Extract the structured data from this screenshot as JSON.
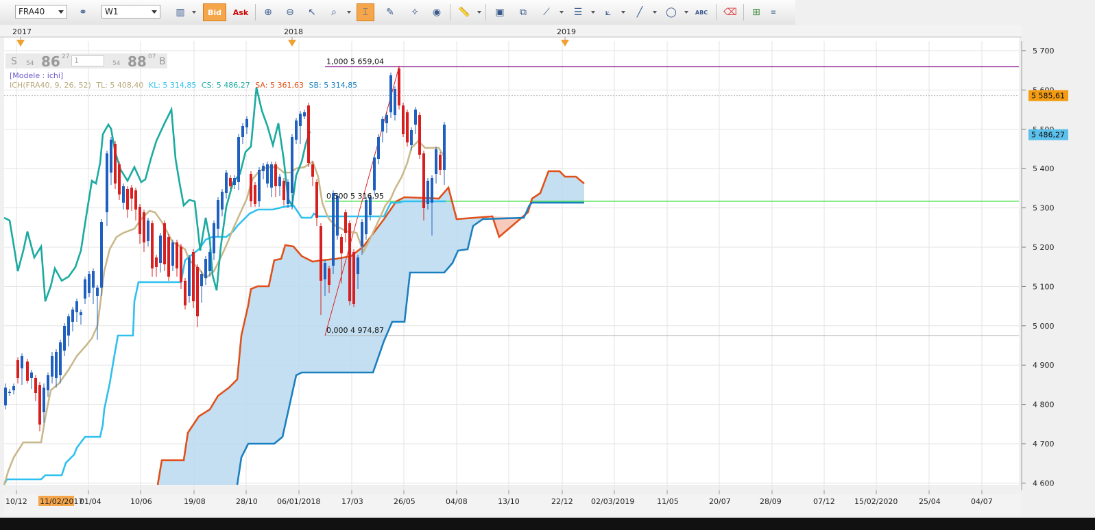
{
  "toolbar": {
    "symbol": "FRA40",
    "timeframe": "W1",
    "bid_label": "Bid",
    "ask_label": "Ask",
    "icons": [
      "chart-type-icon",
      "crosshair-icon",
      "zoom-in-icon",
      "zoom-out-icon",
      "cursor-icon",
      "zoom-box-icon",
      "period-icon",
      "edit-icon",
      "magic-icon",
      "globe-icon",
      "ruler-icon",
      "image-icon",
      "screenshot-icon",
      "trendline-icon",
      "levels-icon",
      "fibonacci-icon",
      "line-tool-icon",
      "ellipse-icon",
      "text-tool-icon",
      "eraser-icon",
      "indicators-icon",
      "more-icon"
    ]
  },
  "quote": {
    "sell_prefix": "S",
    "sell_small": "54",
    "sell_big": "86",
    "sell_sup": "27",
    "qty": "1",
    "buy_small": "54",
    "buy_big": "88",
    "buy_sup": "07",
    "buy_suffix": "B"
  },
  "legend": {
    "model": "[Modele : ichi]",
    "ich": "ICH(FRA40, 9, 26, 52)",
    "tl": "TL: 5 408,40",
    "kl": "KL: 5 314,85",
    "cs": "CS: 5 486,27",
    "sa": "SA: 5 361,63",
    "sb": "SB: 5 314,85"
  },
  "top_axis": {
    "years": [
      "2017",
      "2018",
      "2019"
    ]
  },
  "price_badges": [
    {
      "label": "5 585,61",
      "color": "#f39c12"
    },
    {
      "label": "5 486,27",
      "color": "#5bc0eb"
    }
  ],
  "fibonacci": [
    {
      "label": "1,000 5 659,04",
      "price": 5659.04
    },
    {
      "label": "0,500 5 316,95",
      "price": 5316.95
    },
    {
      "label": "0,000 4 974,87",
      "price": 4974.87
    }
  ],
  "chart_data": {
    "type": "candlestick",
    "title": "",
    "ylim": [
      4580,
      5720
    ],
    "y_ticks": [
      "5 700",
      "5 600",
      "5 500",
      "5 400",
      "5 300",
      "5 200",
      "5 100",
      "5 000",
      "4 900",
      "4 800",
      "4 700",
      "4 600"
    ],
    "x_tick_labels": [
      "10/12",
      "11/02/2017",
      "01/04",
      "10/06",
      "19/08",
      "28/10",
      "06/01/2018",
      "17/03",
      "26/05",
      "04/08",
      "13/10",
      "22/12",
      "02/03/2019",
      "11/05",
      "20/07",
      "28/09",
      "07/12",
      "15/02/2020",
      "25/04",
      "04/07"
    ],
    "highlighted_x_label": "11/02/2017",
    "horizontal_lines": [
      {
        "price": 5659.04,
        "color": "#8b1a8b"
      },
      {
        "price": 5316.95,
        "color": "#33dd33"
      },
      {
        "price": 5585.61,
        "color": "#bbbbbb"
      },
      {
        "price": 4974.87,
        "color": "#bbbbbb"
      }
    ],
    "colors": {
      "up": "#1f5fbf",
      "down": "#d81f1f",
      "tenkan": "#c8b88a",
      "kijun": "#2ec0f0",
      "chikou": "#1aaaa0",
      "senkou_a": "#e0501a",
      "senkou_b": "#1a7fbf",
      "cloud_bull": "#b8d9ee",
      "cloud_bear": "#f6c4b4"
    }
  }
}
